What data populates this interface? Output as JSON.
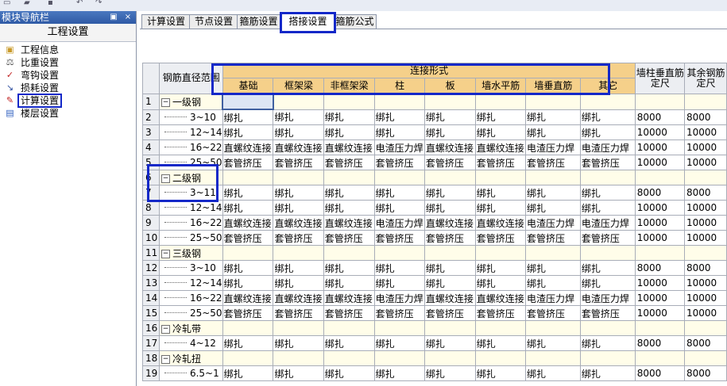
{
  "nav": {
    "title": "模块导航栏",
    "pin_glyph": "▣",
    "close_glyph": "×",
    "section": "工程设置",
    "items": [
      {
        "label": "工程信息",
        "icon": "folder-icon",
        "glyph": "▣",
        "color": "#c89a2a"
      },
      {
        "label": "比重设置",
        "icon": "weight-icon",
        "glyph": "⚖",
        "color": "#555"
      },
      {
        "label": "弯钩设置",
        "icon": "hook-icon",
        "glyph": "✓",
        "color": "#c02020"
      },
      {
        "label": "损耗设置",
        "icon": "loss-icon",
        "glyph": "↘",
        "color": "#3050a0"
      },
      {
        "label": "计算设置",
        "icon": "calc-icon",
        "glyph": "✎",
        "color": "#c02020"
      },
      {
        "label": "楼层设置",
        "icon": "floor-icon",
        "glyph": "▤",
        "color": "#3060c0"
      }
    ],
    "selected_index": 4
  },
  "tabs": [
    "计算设置",
    "节点设置",
    "箍筋设置",
    "搭接设置",
    "箍筋公式"
  ],
  "active_tab": 3,
  "table": {
    "header_range": "钢筋直径范围",
    "header_group": "连接形式",
    "sub_headers": [
      "基础",
      "框架梁",
      "非框架梁",
      "柱",
      "板",
      "墙水平筋",
      "墙垂直筋",
      "其它"
    ],
    "header_wall": "墙柱垂直筋定尺",
    "header_other": "其余钢筋定尺",
    "rows": [
      {
        "n": "1",
        "kind": "group",
        "label": "一级钢",
        "cells": [
          "",
          "",
          "",
          "",
          "",
          "",
          "",
          ""
        ],
        "a": "",
        "b": ""
      },
      {
        "n": "2",
        "kind": "sub",
        "label": "3~10",
        "cells": [
          "绑扎",
          "绑扎",
          "绑扎",
          "绑扎",
          "绑扎",
          "绑扎",
          "绑扎",
          "绑扎"
        ],
        "a": "8000",
        "b": "8000"
      },
      {
        "n": "3",
        "kind": "sub",
        "label": "12~14",
        "cells": [
          "绑扎",
          "绑扎",
          "绑扎",
          "绑扎",
          "绑扎",
          "绑扎",
          "绑扎",
          "绑扎"
        ],
        "a": "10000",
        "b": "10000"
      },
      {
        "n": "4",
        "kind": "sub",
        "label": "16~22",
        "cells": [
          "直螺纹连接",
          "直螺纹连接",
          "直螺纹连接",
          "电渣压力焊",
          "直螺纹连接",
          "直螺纹连接",
          "电渣压力焊",
          "电渣压力焊"
        ],
        "a": "10000",
        "b": "10000"
      },
      {
        "n": "5",
        "kind": "sub",
        "label": "25~50",
        "cells": [
          "套管挤压",
          "套管挤压",
          "套管挤压",
          "套管挤压",
          "套管挤压",
          "套管挤压",
          "套管挤压",
          "套管挤压"
        ],
        "a": "10000",
        "b": "10000"
      },
      {
        "n": "6",
        "kind": "group",
        "label": "二级钢",
        "cells": [
          "",
          "",
          "",
          "",
          "",
          "",
          "",
          ""
        ],
        "a": "",
        "b": ""
      },
      {
        "n": "7",
        "kind": "sub",
        "label": "3~11.",
        "cells": [
          "绑扎",
          "绑扎",
          "绑扎",
          "绑扎",
          "绑扎",
          "绑扎",
          "绑扎",
          "绑扎"
        ],
        "a": "8000",
        "b": "8000"
      },
      {
        "n": "8",
        "kind": "sub",
        "label": "12~14",
        "cells": [
          "绑扎",
          "绑扎",
          "绑扎",
          "绑扎",
          "绑扎",
          "绑扎",
          "绑扎",
          "绑扎"
        ],
        "a": "10000",
        "b": "10000"
      },
      {
        "n": "9",
        "kind": "sub",
        "label": "16~22",
        "cells": [
          "直螺纹连接",
          "直螺纹连接",
          "直螺纹连接",
          "电渣压力焊",
          "直螺纹连接",
          "直螺纹连接",
          "电渣压力焊",
          "电渣压力焊"
        ],
        "a": "10000",
        "b": "10000"
      },
      {
        "n": "10",
        "kind": "sub",
        "label": "25~50",
        "cells": [
          "套管挤压",
          "套管挤压",
          "套管挤压",
          "套管挤压",
          "套管挤压",
          "套管挤压",
          "套管挤压",
          "套管挤压"
        ],
        "a": "10000",
        "b": "10000"
      },
      {
        "n": "11",
        "kind": "group",
        "label": "三级钢",
        "cells": [
          "",
          "",
          "",
          "",
          "",
          "",
          "",
          ""
        ],
        "a": "",
        "b": ""
      },
      {
        "n": "12",
        "kind": "sub",
        "label": "3~10",
        "cells": [
          "绑扎",
          "绑扎",
          "绑扎",
          "绑扎",
          "绑扎",
          "绑扎",
          "绑扎",
          "绑扎"
        ],
        "a": "8000",
        "b": "8000"
      },
      {
        "n": "13",
        "kind": "sub",
        "label": "12~14",
        "cells": [
          "绑扎",
          "绑扎",
          "绑扎",
          "绑扎",
          "绑扎",
          "绑扎",
          "绑扎",
          "绑扎"
        ],
        "a": "10000",
        "b": "10000"
      },
      {
        "n": "14",
        "kind": "sub",
        "label": "16~22",
        "cells": [
          "直螺纹连接",
          "直螺纹连接",
          "直螺纹连接",
          "电渣压力焊",
          "直螺纹连接",
          "直螺纹连接",
          "电渣压力焊",
          "电渣压力焊"
        ],
        "a": "10000",
        "b": "10000"
      },
      {
        "n": "15",
        "kind": "sub",
        "label": "25~50",
        "cells": [
          "套管挤压",
          "套管挤压",
          "套管挤压",
          "套管挤压",
          "套管挤压",
          "套管挤压",
          "套管挤压",
          "套管挤压"
        ],
        "a": "10000",
        "b": "10000"
      },
      {
        "n": "16",
        "kind": "group",
        "label": "冷轧带",
        "cells": [
          "",
          "",
          "",
          "",
          "",
          "",
          "",
          ""
        ],
        "a": "",
        "b": ""
      },
      {
        "n": "17",
        "kind": "sub",
        "label": "4~12",
        "cells": [
          "绑扎",
          "绑扎",
          "绑扎",
          "绑扎",
          "绑扎",
          "绑扎",
          "绑扎",
          "绑扎"
        ],
        "a": "8000",
        "b": "8000"
      },
      {
        "n": "18",
        "kind": "group",
        "label": "冷轧扭",
        "cells": [
          "",
          "",
          "",
          "",
          "",
          "",
          "",
          ""
        ],
        "a": "",
        "b": ""
      },
      {
        "n": "19",
        "kind": "sub",
        "label": "6.5~1",
        "cells": [
          "绑扎",
          "绑扎",
          "绑扎",
          "绑扎",
          "绑扎",
          "绑扎",
          "绑扎",
          "绑扎"
        ],
        "a": "8000",
        "b": "8000"
      }
    ]
  }
}
